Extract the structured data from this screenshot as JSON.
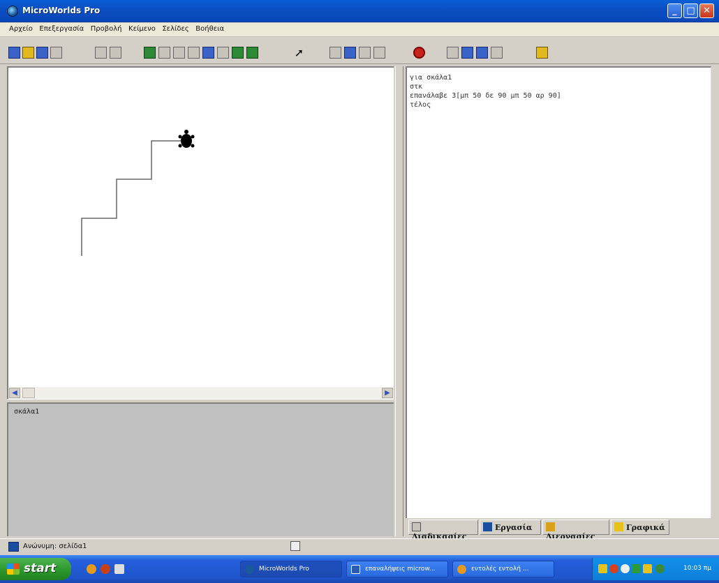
{
  "window": {
    "title": "MicroWorlds Pro"
  },
  "menu": [
    "Αρχείο",
    "Επεξεργασία",
    "Προβολή",
    "Κείμενο",
    "Σελίδες",
    "Βοήθεια"
  ],
  "command_center": {
    "text": "σκάλα1"
  },
  "procedures": {
    "lines": [
      "για σκάλα1",
      "στκ",
      "επανάλαβε 3[μπ 50 δε 90 μπ 50 αρ 90]",
      "τέλος"
    ]
  },
  "tabs": [
    "Διαδικασίες",
    "Εργασία",
    "Διεργασίες",
    "Γραφικά"
  ],
  "status": {
    "project_name": "Ανώνυμη: σελίδα1"
  },
  "taskbar": {
    "start_label": "start",
    "tasks": [
      "MicroWorlds Pro",
      "επαναλήψεις microw...",
      "εντολές εντολή ..."
    ],
    "clock": "10:03 πμ"
  },
  "colors": {
    "titlebar": "#0b4fc3",
    "taskbar": "#245edb",
    "start": "#2f9a2f"
  },
  "drawing": {
    "pen_color": "#666666",
    "steps": 3,
    "step_length": 50,
    "turtle": "turtle-icon"
  }
}
